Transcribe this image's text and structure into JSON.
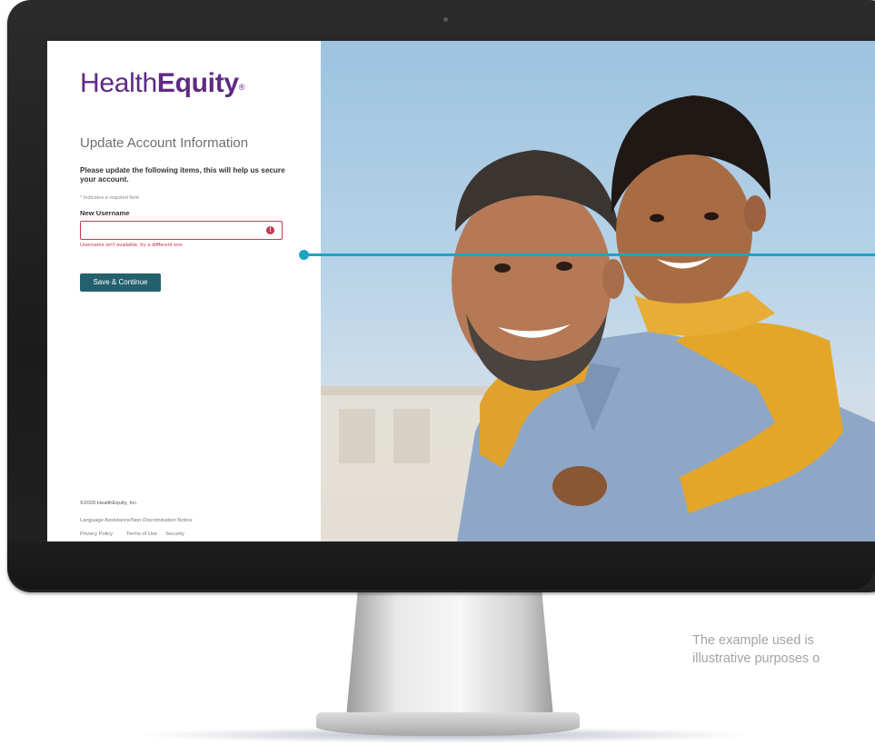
{
  "brand": {
    "name_regular": "Health",
    "name_bold": "Equity",
    "trademark": "®",
    "color": "#5e2a84"
  },
  "form": {
    "title": "Update Account Information",
    "instructions": "Please update the following items, this will help us secure your account.",
    "required_note": "* Indicates a required field",
    "username_label": "New Username",
    "username_value": "",
    "error_icon": "exclamation-circle-icon",
    "error_message": "Username isn't available, try a diffferent one",
    "submit_label": "Save & Continue",
    "error_color": "#c9354f",
    "button_color": "#25606e"
  },
  "footer": {
    "copyright": "©2020 HealthEquity, Inc.",
    "language_link": "Language Assistance/Non-Discrimination Notice",
    "privacy_link": "Privacy Policy",
    "terms_link": "Terms of Use",
    "security_link": "Security"
  },
  "callout": {
    "color": "#1fa3c4"
  },
  "disclaimer": {
    "line1": "The example used is",
    "line2": "illustrative purposes o"
  }
}
